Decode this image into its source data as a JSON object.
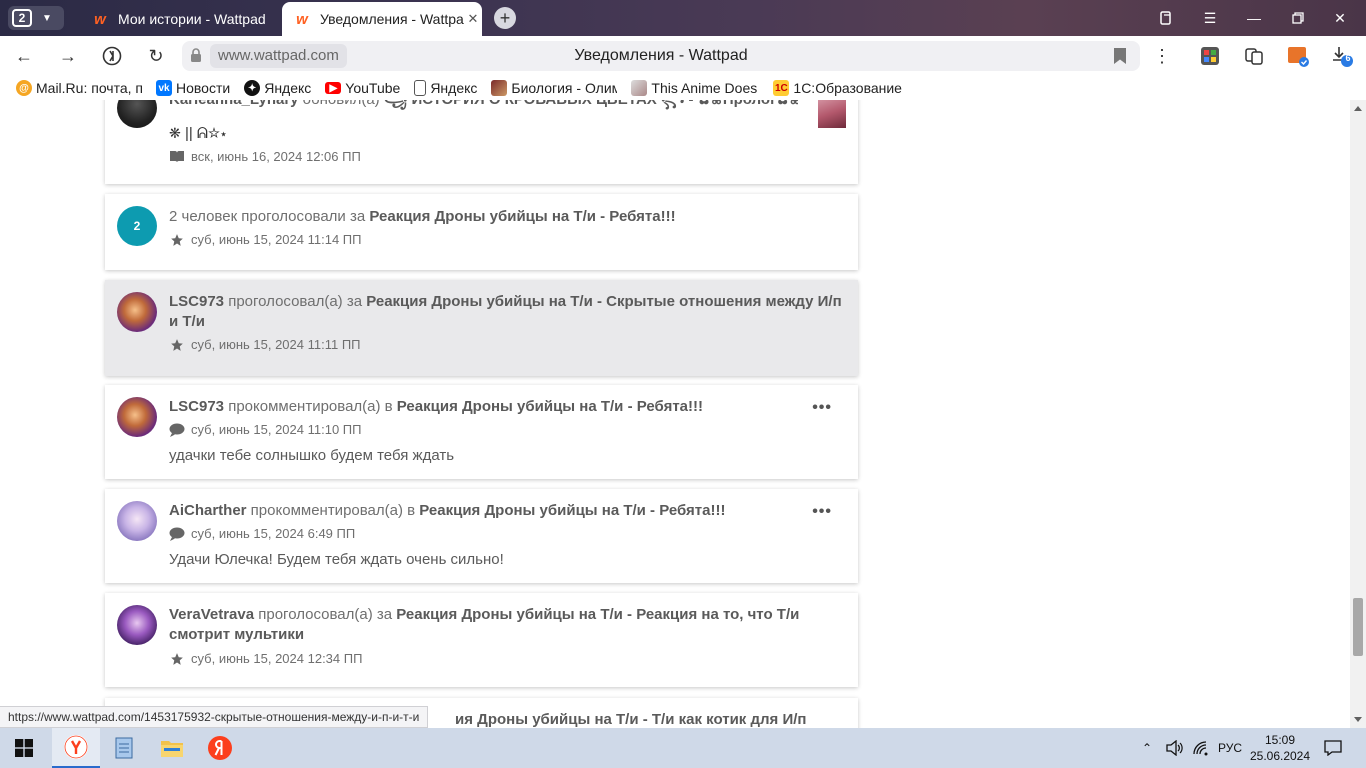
{
  "browser": {
    "tab_count": "2",
    "tabs": [
      {
        "title": "Мои истории - Wattpad",
        "active": false
      },
      {
        "title": "Уведомления - Wattpad",
        "active": true
      }
    ],
    "address": {
      "domain": "www.wattpad.com",
      "page_title": "Уведомления - Wattpad"
    },
    "downloads_badge": "6",
    "bookmarks": [
      {
        "label": "Mail.Ru: почта, поиск",
        "icon": "mailru-icon"
      },
      {
        "label": "Новости",
        "icon": "vk-icon"
      },
      {
        "label": "Яндекс",
        "icon": "yandex-dark-icon"
      },
      {
        "label": "YouTube",
        "icon": "youtube-icon"
      },
      {
        "label": "Яндекс",
        "icon": "document-icon"
      },
      {
        "label": "Биология - Олимпиада",
        "icon": "biology-icon"
      },
      {
        "label": "This Anime Does Not",
        "icon": "anime-icon"
      },
      {
        "label": "1С:Образование",
        "icon": "1c-icon"
      }
    ]
  },
  "notifications": [
    {
      "user": "Karleanna_Lynary",
      "action": " обновил(а) ",
      "target": "꧁ ИСТОРИЯ О КРОВАВЫХ ЦВЕТАХ ꧂ - ✿❀Пролог✿❀",
      "extra": "❋ || ᕱ☆⋆",
      "icon": "book-icon",
      "time": "вск, июнь 16, 2024 12:06 ПП"
    },
    {
      "count": "2",
      "action": "2 человек проголосовали за ",
      "target": "Реакция Дроны убийцы на Т/и - Ребята!!!",
      "icon": "star-icon",
      "time": "суб, июнь 15, 2024 11:14 ПП"
    },
    {
      "user": "LSC973",
      "action": " проголосовал(а) за ",
      "target": "Реакция Дроны убийцы на Т/и - Скрытые отношения между И/п и Т/и",
      "icon": "star-icon",
      "time": "суб, июнь 15, 2024 11:11 ПП"
    },
    {
      "user": "LSC973",
      "action": " прокомментировал(а) в ",
      "target": "Реакция Дроны убийцы на Т/и - Ребята!!!",
      "icon": "comment-icon",
      "time": "суб, июнь 15, 2024 11:10 ПП",
      "comment": "удачки тебе солнышко будем тебя ждать"
    },
    {
      "user": "AiCharther",
      "action": " прокомментировал(а) в ",
      "target": "Реакция Дроны убийцы на Т/и - Ребята!!!",
      "icon": "comment-icon",
      "time": "суб, июнь 15, 2024 6:49 ПП",
      "comment": "Удачи Юлечка! Будем тебя ждать очень сильно!"
    },
    {
      "user": "VeraVetrava",
      "action": " проголосовал(а) за ",
      "target": "Реакция Дроны убийцы на Т/и - Реакция на то, что Т/и смотрит мультики",
      "icon": "star-icon",
      "time": "суб, июнь 15, 2024 12:34 ПП"
    },
    {
      "target_partial": "ия Дроны убийцы на Т/и - Т/и как котик для И/п"
    }
  ],
  "more_menu_label": "•••",
  "status_link": "https://www.wattpad.com/1453175932-скрытые-отношения-между-и-п-и-т-и",
  "taskbar": {
    "language": "РУС",
    "time": "15:09",
    "date": "25.06.2024"
  },
  "colors": {
    "wattpad_orange": "#ff6122",
    "count_badge": "#0d9bb0",
    "highlight_card": "#e9e9eb"
  }
}
